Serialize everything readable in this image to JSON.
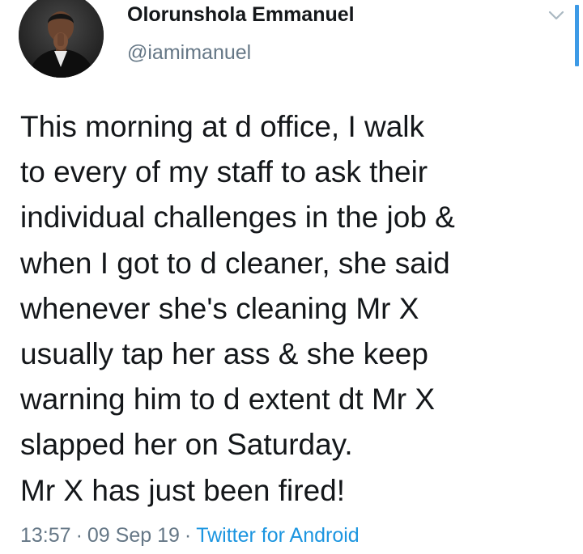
{
  "author": {
    "display_name": "Olorunshola Emmanuel",
    "handle": "@iamimanuel",
    "avatar_icon": "user-avatar"
  },
  "tweet": {
    "lines": [
      "This morning at d office, I walk",
      "to every of my staff to ask their",
      "individual challenges in the job &",
      "when I got to d cleaner, she said",
      "whenever she's cleaning Mr X",
      "usually tap her ass & she keep",
      "warning him to d extent dt Mr X",
      "slapped her on Saturday.",
      "Mr X has just been fired!"
    ]
  },
  "meta": {
    "time": "13:57",
    "separator": "·",
    "date": "09 Sep 19",
    "source": "Twitter for Android"
  },
  "icons": {
    "more": "chevron-down-icon"
  },
  "colors": {
    "text": "#14171a",
    "secondary": "#657786",
    "link": "#1b95e0",
    "scrollbar": "#3d9ae6"
  }
}
